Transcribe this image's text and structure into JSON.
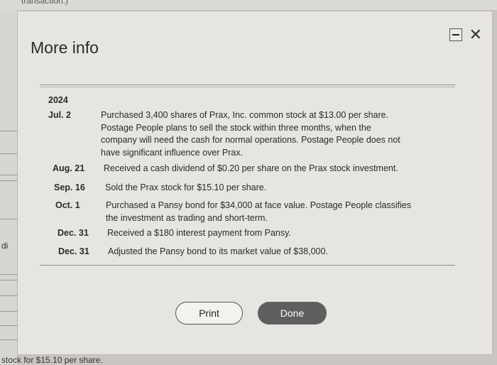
{
  "background": {
    "top_text": "transaction.)",
    "left_text": "di",
    "bottom_text": "stock for $15.10 per share."
  },
  "modal": {
    "title": "More info",
    "minimize_icon": "minimize-icon",
    "close_icon": "close-icon",
    "close_glyph": "✕",
    "year": "2024",
    "entries": [
      {
        "date": "Jul. 2",
        "text": [
          "Purchased 3,400 shares of Prax, Inc. common stock at $13.00 per share.",
          "Postage People plans to sell the stock within three months, when the",
          "company will need the cash for normal operations. Postage People does not",
          "have significant influence over Prax."
        ]
      },
      {
        "date": "Aug. 21",
        "text": [
          "Received a cash dividend of $0.20 per share on the Prax stock investment."
        ]
      },
      {
        "date": "Sep. 16",
        "text": [
          "Sold the Prax stock for $15.10 per share."
        ]
      },
      {
        "date": "Oct. 1",
        "text": [
          "Purchased a Pansy bond for $34,000 at face value. Postage People classifies",
          "the investment as trading and short-term."
        ]
      },
      {
        "date": "Dec. 31",
        "text": [
          "Received a $180 interest payment from Pansy."
        ]
      },
      {
        "date": "Dec. 31",
        "text": [
          "Adjusted the Pansy bond to its market value of $38,000."
        ]
      }
    ],
    "print_label": "Print",
    "done_label": "Done"
  }
}
